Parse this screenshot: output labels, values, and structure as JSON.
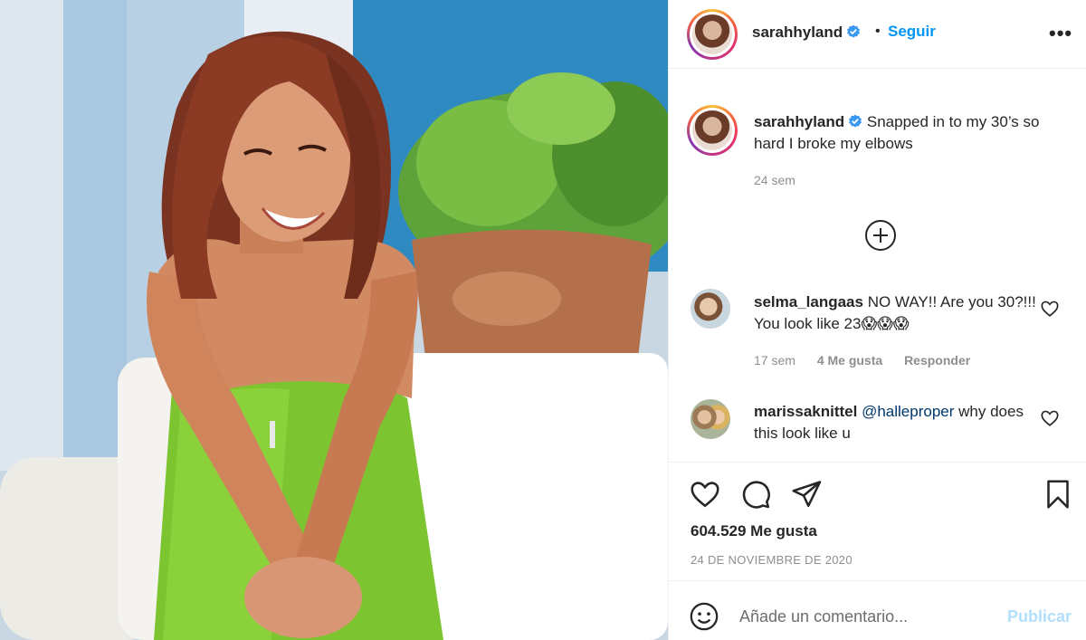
{
  "colors": {
    "accent": "#0095f6",
    "verified": "#3897f0",
    "muted": "#8e8e8e",
    "publish_disabled": "#b2dffc"
  },
  "photo": {
    "alt_icon": "post-photo"
  },
  "header": {
    "username": "sarahhyland",
    "separator": "•",
    "follow_label": "Seguir",
    "more_label": "•••"
  },
  "caption": {
    "username": "sarahhyland",
    "text": "Snapped in to my 30’s so hard I broke my elbows",
    "time": "24 sem"
  },
  "comments": [
    {
      "username": "selma_langaas",
      "text": "NO WAY!! Are you 30?!!! You look like 23😱😱😱",
      "time": "17 sem",
      "likes": "4 Me gusta",
      "reply_label": "Responder"
    },
    {
      "username": "marissaknittel",
      "mention": "@halleproper",
      "text": " why does this look like u"
    }
  ],
  "actions": {
    "like_icon": "heart-icon",
    "comment_icon": "comment-icon",
    "share_icon": "share-icon",
    "save_icon": "bookmark-icon",
    "likes_text": "604.529 Me gusta",
    "date": "24 DE NOVIEMBRE DE 2020"
  },
  "add_comment": {
    "placeholder": "Añade un comentario...",
    "publish_label": "Publicar"
  }
}
